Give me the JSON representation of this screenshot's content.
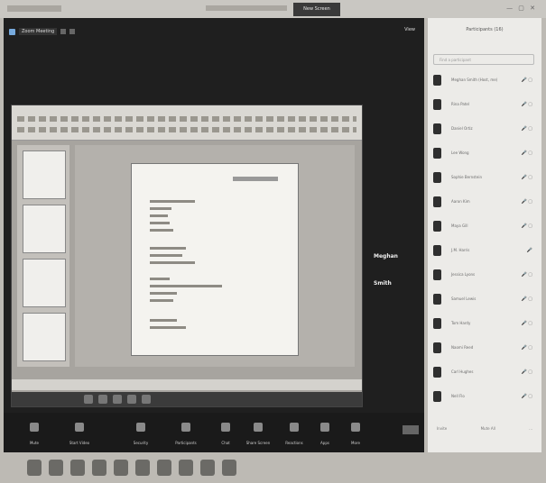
{
  "zoom": {
    "meeting_label": "Zoom Meeting",
    "window_tab": "New Screen",
    "view_label": "View",
    "presenter_name_top": "Meghan",
    "presenter_name_bottom": "Smith",
    "controls": [
      "Mute",
      "Start Video",
      "Security",
      "Participants",
      "Chat",
      "Share Screen",
      "Reactions",
      "Apps",
      "More"
    ]
  },
  "participants": {
    "title": "Participants (16)",
    "search_placeholder": "Find a participant",
    "list": [
      {
        "name": "Meghan Smith (Host, me)",
        "icons": "🎤 ▢"
      },
      {
        "name": "Rina Patel",
        "icons": "🎤 ▢"
      },
      {
        "name": "Daniel Ortiz",
        "icons": "🎤 ▢"
      },
      {
        "name": "Lee Wong",
        "icons": "🎤 ▢"
      },
      {
        "name": "Sophie Bernstein",
        "icons": "🎤 ▢"
      },
      {
        "name": "Aaron Kim",
        "icons": "🎤 ▢"
      },
      {
        "name": "Maya Gill",
        "icons": "🎤 ▢"
      },
      {
        "name": "J.M. Harris",
        "icons": "🎤"
      },
      {
        "name": "Jessica Lyons",
        "icons": "🎤 ▢"
      },
      {
        "name": "Samuel Lewis",
        "icons": "🎤 ▢"
      },
      {
        "name": "Tom Hardy",
        "icons": "🎤 ▢"
      },
      {
        "name": "Naomi Reed",
        "icons": "🎤 ▢"
      },
      {
        "name": "Carl Hughes",
        "icons": "🎤 ▢"
      },
      {
        "name": "Nell Flo",
        "icons": "🎤 ▢"
      }
    ],
    "footer_left": "Invite",
    "footer_mid": "Mute All",
    "footer_right": "..."
  }
}
